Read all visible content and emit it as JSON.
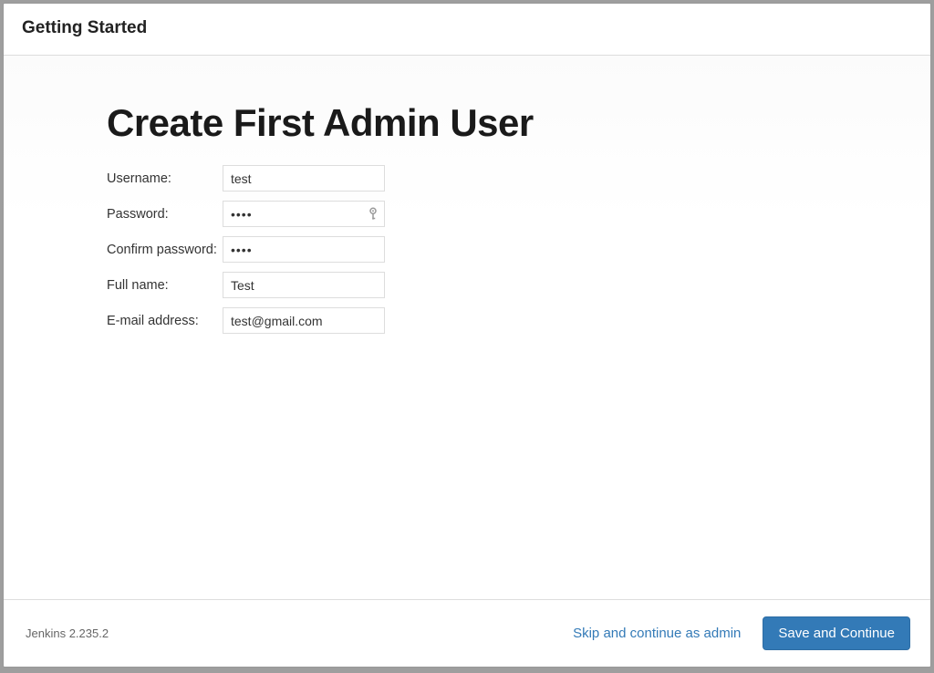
{
  "header": {
    "title": "Getting Started"
  },
  "main": {
    "heading": "Create First Admin User",
    "fields": {
      "username": {
        "label": "Username:",
        "value": "test"
      },
      "password": {
        "label": "Password:",
        "value": "test"
      },
      "confirm": {
        "label": "Confirm password:",
        "value": "test"
      },
      "fullname": {
        "label": "Full name:",
        "value": "Test"
      },
      "email": {
        "label": "E-mail address:",
        "value": "test@gmail.com"
      }
    }
  },
  "footer": {
    "version": "Jenkins 2.235.2",
    "skip_label": "Skip and continue as admin",
    "save_label": "Save and Continue"
  }
}
